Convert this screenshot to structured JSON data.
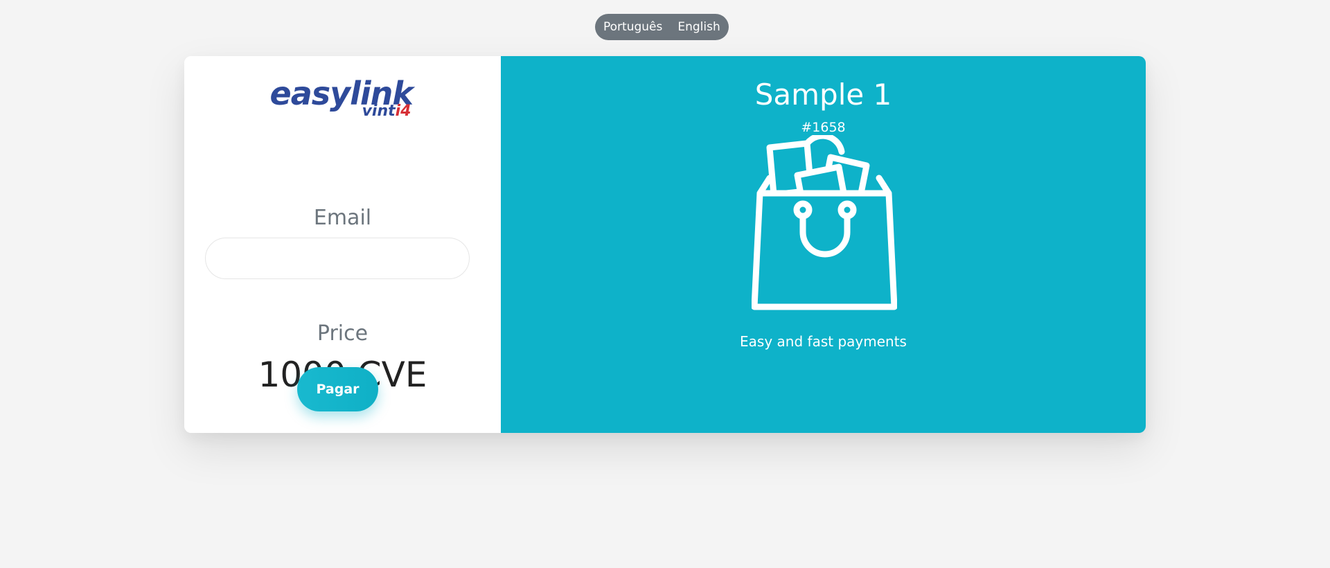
{
  "language_switch": {
    "options": [
      "Português",
      "English"
    ]
  },
  "logo": {
    "main_text": "easylink",
    "sub_text_prefix": "vint",
    "sub_text_accent": "i4"
  },
  "form": {
    "email_label": "Email",
    "email_value": "",
    "email_placeholder": "",
    "price_label": "Price",
    "price_value": "1000 CVE",
    "pay_button_label": "Pagar"
  },
  "product": {
    "title": "Sample 1",
    "order_number": "#1658",
    "icon": "shopping-bag-icon",
    "tagline": "Easy and fast payments"
  },
  "colors": {
    "accent": "#0eb2c9",
    "brand_blue": "#2e4a9a",
    "brand_red": "#d63036",
    "lang_switch_bg": "#6c757d",
    "page_bg": "#f4f4f4"
  }
}
